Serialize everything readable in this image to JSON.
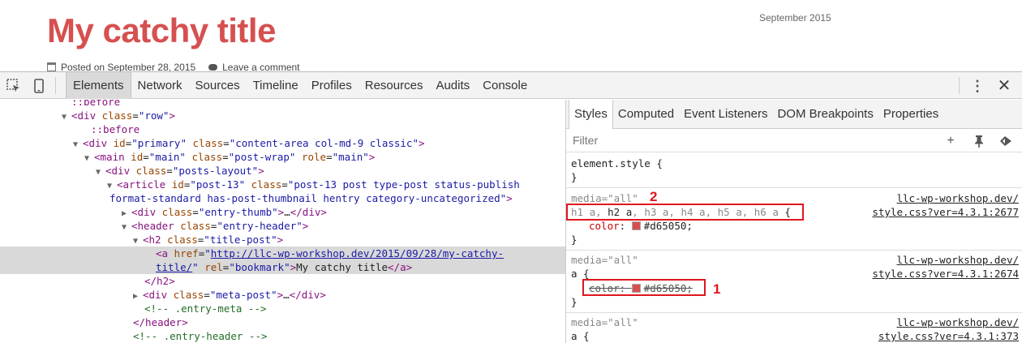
{
  "page": {
    "post_title": "My catchy title",
    "sidebar_date": "September 2015",
    "posted_on": "Posted on September 28, 2015",
    "leave_comment": "Leave a comment"
  },
  "devtools": {
    "tabs": [
      "Elements",
      "Network",
      "Sources",
      "Timeline",
      "Profiles",
      "Resources",
      "Audits",
      "Console"
    ],
    "active_tab": "Elements",
    "tree": {
      "l0": "::before",
      "l1_tag": "div",
      "l1_attr": "class",
      "l1_val": "row",
      "l2": "::before",
      "l3_tag": "div",
      "l3_a1": "id",
      "l3_v1": "primary",
      "l3_a2": "class",
      "l3_v2": "content-area col-md-9 classic",
      "l4_tag": "main",
      "l4_a1": "id",
      "l4_v1": "main",
      "l4_a2": "class",
      "l4_v2": "post-wrap",
      "l4_a3": "role",
      "l4_v3": "main",
      "l5_tag": "div",
      "l5_a1": "class",
      "l5_v1": "posts-layout",
      "l6_tag": "article",
      "l6_a1": "id",
      "l6_v1": "post-13",
      "l6_a2": "class",
      "l6_v2a": "post-13 post type-post status-publish",
      "l7_v2b": "format-standard has-post-thumbnail hentry category-uncategorized",
      "l8_tag": "div",
      "l8_a1": "class",
      "l8_v1": "entry-thumb",
      "l8_ellipsis": "…",
      "l9_tag": "header",
      "l9_a1": "class",
      "l9_v1": "entry-header",
      "l10_tag": "h2",
      "l10_a1": "class",
      "l10_v1": "title-post",
      "l11_tag": "a",
      "l11_a1": "href",
      "l11_v1a": "http://llc-wp-workshop.dev/2015/09/28/my-catchy-",
      "l12_v1b": "title/",
      "l12_a2": "rel",
      "l12_v2": "bookmark",
      "l12_text": "My catchy title",
      "l13_close": "/h2",
      "l14_tag": "div",
      "l14_a1": "class",
      "l14_v1": "meta-post",
      "l14_ellipsis": "…",
      "l15_comment": "<!-- .entry-meta -->",
      "l16_close": "/header",
      "l17_comment": "<!-- .entry-header -->"
    },
    "styles": {
      "tabs": [
        "Styles",
        "Computed",
        "Event Listeners",
        "DOM Breakpoints",
        "Properties"
      ],
      "active_tab": "Styles",
      "filter_placeholder": "Filter",
      "element_style": "element.style {",
      "close_brace": "}",
      "media_all": "media=\"all\"",
      "rule1": {
        "selector_parts": [
          "h1 a, ",
          "h2 a",
          ", h3 a, h4 a, h5 a, h6 a"
        ],
        "open": " {",
        "prop": "color",
        "value": "#d65050",
        "source_a": "llc-wp-workshop.dev/",
        "source_b": "style.css?ver=4.3.1:2677"
      },
      "rule2": {
        "selector": "a {",
        "prop": "color",
        "value": "#d65050",
        "source_a": "llc-wp-workshop.dev/",
        "source_b": "style.css?ver=4.3.1:2674"
      },
      "rule3": {
        "selector": "a {",
        "source_a": "llc-wp-workshop.dev/",
        "source_b": "style.css?ver=4.3.1:373"
      }
    },
    "annotations": {
      "n1": "1",
      "n2": "2"
    },
    "colors": {
      "accent": "#d65050",
      "callout": "#e0161e"
    }
  }
}
